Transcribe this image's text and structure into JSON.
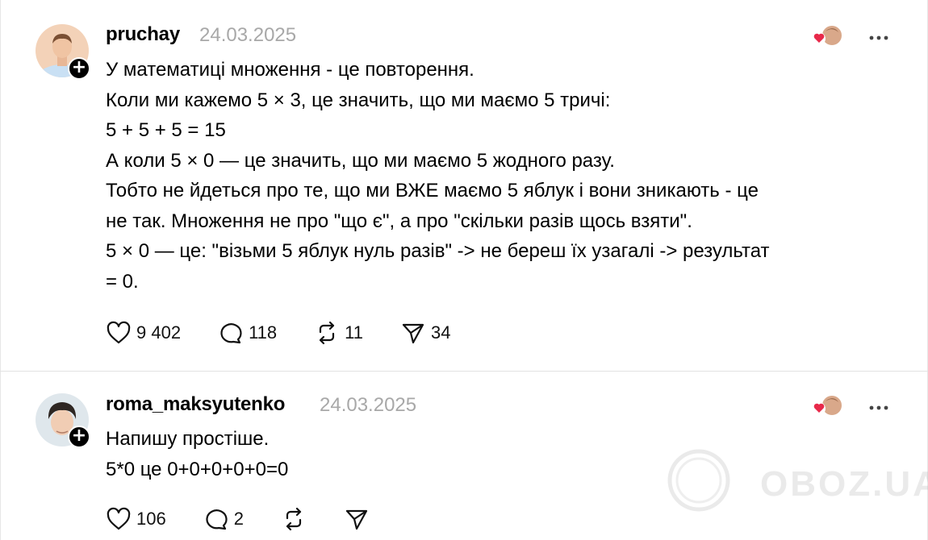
{
  "posts": [
    {
      "username": "pruchay",
      "date": "24.03.2025",
      "text": "У математиці множення - це повторення.\nКоли ми кажемо 5 × 3, це значить, що ми маємо 5 тричі:\n5 + 5 + 5 = 15\nА коли 5 × 0 — це значить, що ми маємо 5 жодного разу.\nТобто не йдеться про те, що ми ВЖЕ маємо 5 яблук і вони зникають - це\nне так. Множення не про \"що є\", а про \"скільки разів щось взяти\".\n5 × 0 — це: \"візьми 5 яблук нуль разів\" -> не береш їх узагалі -> результат\n= 0.",
      "likes": "9 402",
      "comments": "118",
      "reposts": "11",
      "shares": "34"
    },
    {
      "username": "roma_maksyutenko",
      "date": "24.03.2025",
      "text": "Напишу простіше.\n5*0 це 0+0+0+0+0=0",
      "likes": "106",
      "comments": "2"
    }
  ],
  "watermark": "OBOZ.UA",
  "colors": {
    "heart_red": "#e8294a",
    "date_gray": "#a8a8a8",
    "text": "#000000"
  },
  "icons": [
    "plus-icon",
    "heart-icon",
    "comment-icon",
    "repost-icon",
    "share-icon",
    "more-icon",
    "liker-avatars"
  ]
}
